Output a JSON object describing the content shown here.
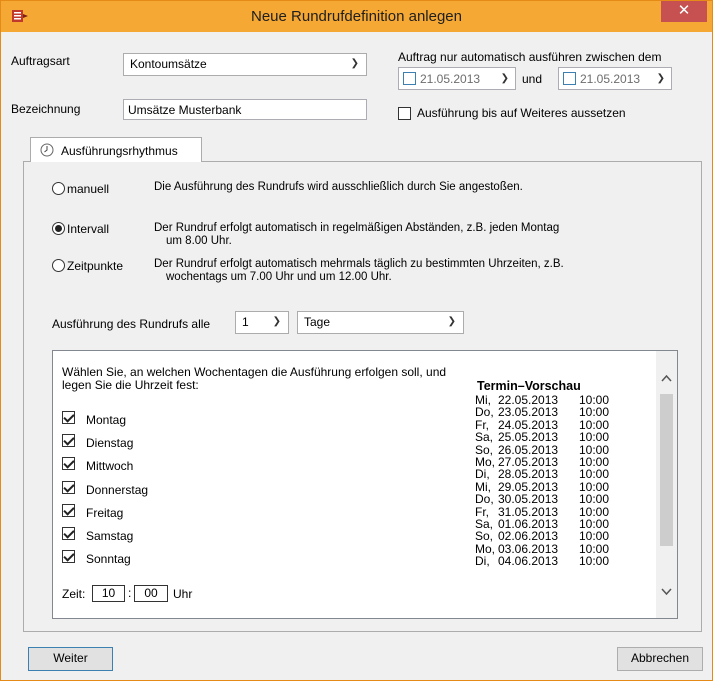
{
  "window": {
    "title": "Neue Rundrufdefinition anlegen",
    "close_glyph": "✕"
  },
  "auftragsart": {
    "label": "Auftragsart",
    "value": "Kontoumsätze"
  },
  "bezeichnung": {
    "label": "Bezeichnung",
    "value": "Umsätze Musterbank"
  },
  "auto": {
    "label": "Auftrag nur automatisch ausführen zwischen dem",
    "from_date": "21.05.2013",
    "and_label": "und",
    "to_date": "21.05.2013",
    "suspend_label": "Ausführung bis auf Weiteres aussetzen",
    "suspend_checked": false
  },
  "tab": {
    "label": "Ausführungsrhythmus",
    "icon": "clock-icon"
  },
  "modes": [
    {
      "label": "manuell",
      "selected": false,
      "description": "Die Ausführung des Rundrufs wird ausschließlich durch Sie angestoßen."
    },
    {
      "label": "Intervall",
      "selected": true,
      "description_line1": "Der Rundruf erfolgt automatisch in regelmäßigen Abständen, z.B. jeden Montag",
      "description_line2": "um 8.00 Uhr."
    },
    {
      "label": "Zeitpunkte",
      "selected": false,
      "description_line1": "Der Rundruf erfolgt automatisch mehrmals täglich zu bestimmten Uhrzeiten, z.B.",
      "description_line2": "wochentags um 7.00 Uhr und um 12.00 Uhr."
    }
  ],
  "interval": {
    "label": "Ausführung des Rundrufs alle",
    "count": "1",
    "unit": "Tage"
  },
  "weekdays": {
    "instruction_line1": "Wählen Sie, an welchen Wochentagen die Ausführung erfolgen soll, und",
    "instruction_line2": "legen Sie die Uhrzeit fest:",
    "days": [
      {
        "label": "Montag",
        "checked": true
      },
      {
        "label": "Dienstag",
        "checked": true
      },
      {
        "label": "Mittwoch",
        "checked": true
      },
      {
        "label": "Donnerstag",
        "checked": true
      },
      {
        "label": "Freitag",
        "checked": true
      },
      {
        "label": "Samstag",
        "checked": true
      },
      {
        "label": "Sonntag",
        "checked": true
      }
    ]
  },
  "time": {
    "label": "Zeit:",
    "hour": "10",
    "separator": ":",
    "minute": "00",
    "unit": "Uhr"
  },
  "preview": {
    "title": "Termin–Vorschau",
    "rows": [
      {
        "day": "Mi,",
        "date": "22.05.2013",
        "time": "10:00"
      },
      {
        "day": "Do,",
        "date": "23.05.2013",
        "time": "10:00"
      },
      {
        "day": "Fr,",
        "date": "24.05.2013",
        "time": "10:00"
      },
      {
        "day": "Sa,",
        "date": "25.05.2013",
        "time": "10:00"
      },
      {
        "day": "So,",
        "date": "26.05.2013",
        "time": "10:00"
      },
      {
        "day": "Mo,",
        "date": "27.05.2013",
        "time": "10:00"
      },
      {
        "day": "Di,",
        "date": "28.05.2013",
        "time": "10:00"
      },
      {
        "day": "Mi,",
        "date": "29.05.2013",
        "time": "10:00"
      },
      {
        "day": "Do,",
        "date": "30.05.2013",
        "time": "10:00"
      },
      {
        "day": "Fr,",
        "date": "31.05.2013",
        "time": "10:00"
      },
      {
        "day": "Sa,",
        "date": "01.06.2013",
        "time": "10:00"
      },
      {
        "day": "So,",
        "date": "02.06.2013",
        "time": "10:00"
      },
      {
        "day": "Mo,",
        "date": "03.06.2013",
        "time": "10:00"
      },
      {
        "day": "Di,",
        "date": "04.06.2013",
        "time": "10:00"
      }
    ]
  },
  "buttons": {
    "next": "Weiter",
    "cancel": "Abbrechen"
  },
  "colors": {
    "titlebar": "#f5a834",
    "close": "#c75050",
    "accent": "#3c7fb1"
  }
}
